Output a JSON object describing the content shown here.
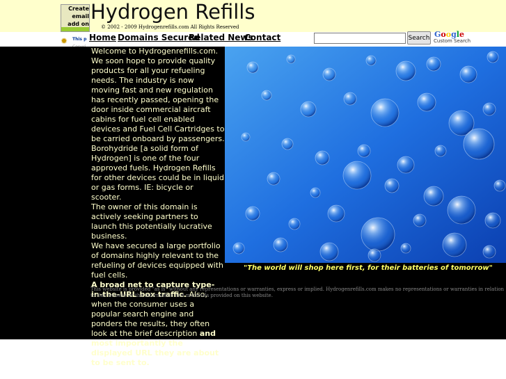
{
  "header": {
    "badge_text": "Create email add on your",
    "site_title": "Hydrogen Refills",
    "copyright": "© 2002 - 2009 Hydrogenrefills.com All Rights Reserved"
  },
  "nav": {
    "items": [
      {
        "label": "Home"
      },
      {
        "label": "Domains Secured"
      },
      {
        "label": "Related News"
      },
      {
        "label": "Contact"
      }
    ]
  },
  "small_notice": {
    "line1": "This p",
    "line2": "Copyri"
  },
  "search": {
    "value": "",
    "button_label": "Search",
    "google_logo": "Google",
    "custom_search_label": "Custom Search"
  },
  "content": {
    "paragraphs": [
      {
        "text": " Welcome to Hydrogenrefills.com. We soon hope to provide quality products for all your refueling needs. The industry is now moving fast and new regulation has recently passed, opening the door inside commercial aircraft cabins for fuel cell enabled devices and Fuel Cell Cartridges to be carried onboard by passengers. Borohydride [a solid form of Hydrogen] is one of the four approved fuels. Hydrogen Refills for other devices could be in liquid or gas forms. IE: bicycle or scooter."
      },
      {
        "text": " The owner of this domain is actively seeking partners to launch this potentially lucrative business."
      },
      {
        "text": " We have secured a large portfolio of domains highly relevant to the refueling of devices equipped with fuel cells."
      }
    ],
    "broad_net_bold": " A broad net to capture type-in-the-URL box traffic.",
    "broad_net_text": "  Also, when the consumer uses a popular search engine and ponders the results, they often look at the brief description ",
    "broad_net_bold2": "and most importantly the displayed URL they are about to be sent to."
  },
  "caption": "\"The world will shop here first, for their batteries of tomorrow\"",
  "disclaimer": "This website is provided \"as is\" without any representations or warranties, express or implied. Hydrogenrefills.com makes no representations or warranties in relation to this website or the information and materials provided on this website.",
  "colors": {
    "header_bg": "#ffffcc",
    "content_bg": "#000000",
    "content_text": "#ffffcc",
    "caption_text": "#ffff66",
    "water_blue": "#1a5fd6"
  },
  "image": {
    "icon": "water-bubbles-photo"
  }
}
